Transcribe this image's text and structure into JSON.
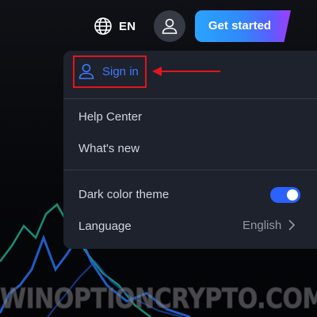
{
  "header": {
    "language_code": "EN",
    "language_icon": "globe-icon",
    "user_icon": "user-icon",
    "cta_label": "Get started"
  },
  "menu": {
    "sign_in_label": "Sign in",
    "sign_in_icon": "user-icon",
    "items": [
      {
        "label": "Help Center"
      },
      {
        "label": "What's new"
      }
    ],
    "dark_theme": {
      "label": "Dark color theme",
      "enabled": true
    },
    "language": {
      "label": "Language",
      "value": "English",
      "icon": "chevron-right-icon"
    }
  },
  "annotation": {
    "highlight_color": "#e0161f"
  },
  "watermark": "WINOPTIONCRYPTO.COM",
  "colors": {
    "menu_bg": "#1e222d",
    "accent_blue": "#2962ff",
    "sign_in_blue": "#3f7bff",
    "text": "#d1d4dc",
    "muted_text": "#9598a1"
  }
}
